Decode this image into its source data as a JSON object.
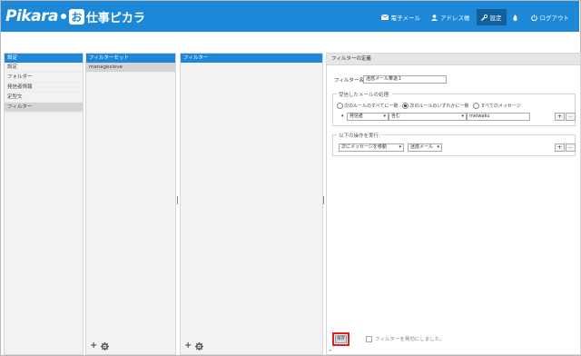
{
  "app": {
    "logo_text": "Pikara",
    "logo_badge": "お",
    "logo_sub": "仕事ピカラ"
  },
  "nav": {
    "mail": "電子メール",
    "addressbook": "アドレス帳",
    "settings": "設定",
    "logout": "ログアウト"
  },
  "settings_col": {
    "header": "設定",
    "items": [
      "設定",
      "フォルダー",
      "発信者情報",
      "定型文",
      "フィルター"
    ],
    "selected_index": 4
  },
  "filterset_col": {
    "header": "フィルターセット",
    "items": [
      "managesieve"
    ]
  },
  "filter_col": {
    "header": "フィルター"
  },
  "main": {
    "header": "フィルターの定義",
    "name_label": "フィルター名:",
    "name_value": "迷惑メール撃退１",
    "rules_legend": "受信したメールの処理:",
    "radio_all": "次のルールのすべてに一致",
    "radio_any": "次のルールのいずれかに一致",
    "radio_every": "すべてのメッセージ",
    "radio_selected": "any",
    "rule_field": "発信者",
    "rule_op": "含む",
    "rule_value": "meiwaku",
    "actions_legend": "以下の操作を実行:",
    "action_type": "次にメッセージを移動",
    "action_folder": "迷惑メール",
    "plus": "+",
    "minus": "−",
    "save_label": "保存",
    "status_text": "フィルターを無効にしました。"
  }
}
